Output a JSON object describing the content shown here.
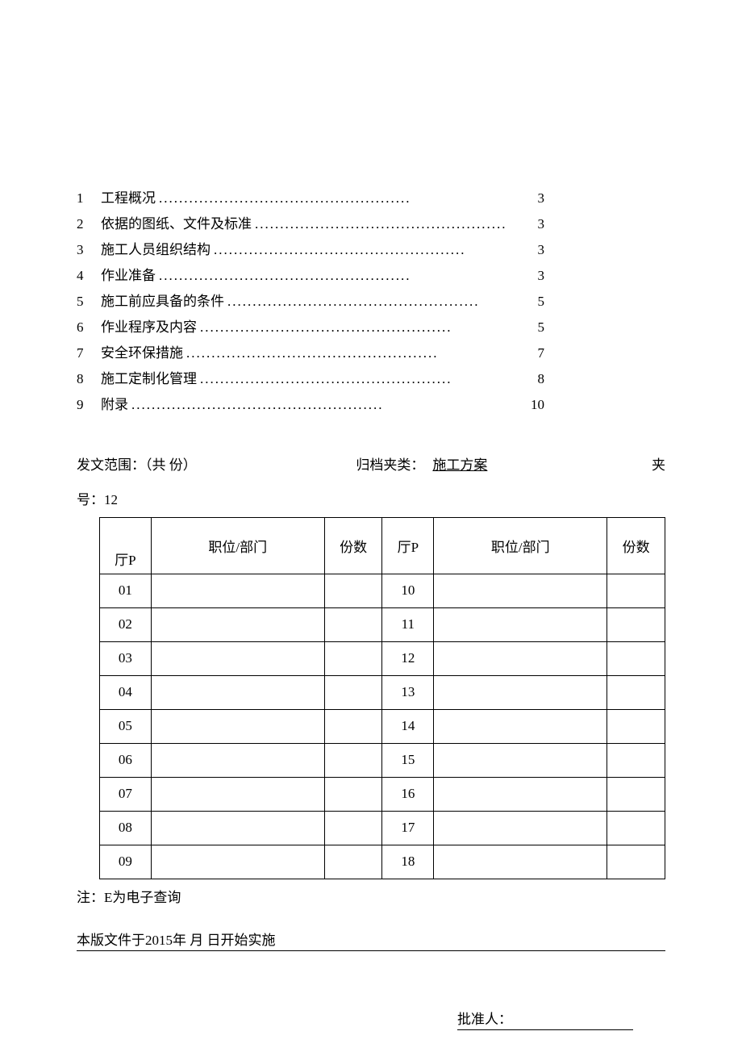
{
  "toc": [
    {
      "num": "1",
      "title": "工程概况",
      "page": "3"
    },
    {
      "num": "2",
      "title": "依据的图纸、文件及标准 ",
      "page": "3"
    },
    {
      "num": "3",
      "title": "施工人员组织结构 ",
      "page": "3"
    },
    {
      "num": "4",
      "title": "作业准备",
      "page": "3"
    },
    {
      "num": "5",
      "title": "施工前应具备的条件 ",
      "page": "5"
    },
    {
      "num": "6",
      "title": "作业程序及内容 ",
      "page": "5"
    },
    {
      "num": "7",
      "title": "安全环保措施 ",
      "page": "7"
    },
    {
      "num": "8",
      "title": "施工定制化管理 ",
      "page": "8"
    },
    {
      "num": "9",
      "title": "附录",
      "page": "10"
    }
  ],
  "dispatch": {
    "scope_label": "发文范围：（共  份）",
    "archive_label": "归档夹类：",
    "archive_value": "施工方案",
    "folder_label": "夹",
    "folder_num_label": "号：12"
  },
  "table": {
    "headers": {
      "seq": "厅P",
      "dept": "职位/部门",
      "count": "份数"
    },
    "left": [
      "01",
      "02",
      "03",
      "04",
      "05",
      "06",
      "07",
      "08",
      "09"
    ],
    "right": [
      "10",
      "11",
      "12",
      "13",
      "14",
      "15",
      "16",
      "17",
      "18"
    ]
  },
  "note": "注：E为电子查询",
  "effective": "本版文件于2015年  月                  日开始实施",
  "approver_label": "批准人："
}
